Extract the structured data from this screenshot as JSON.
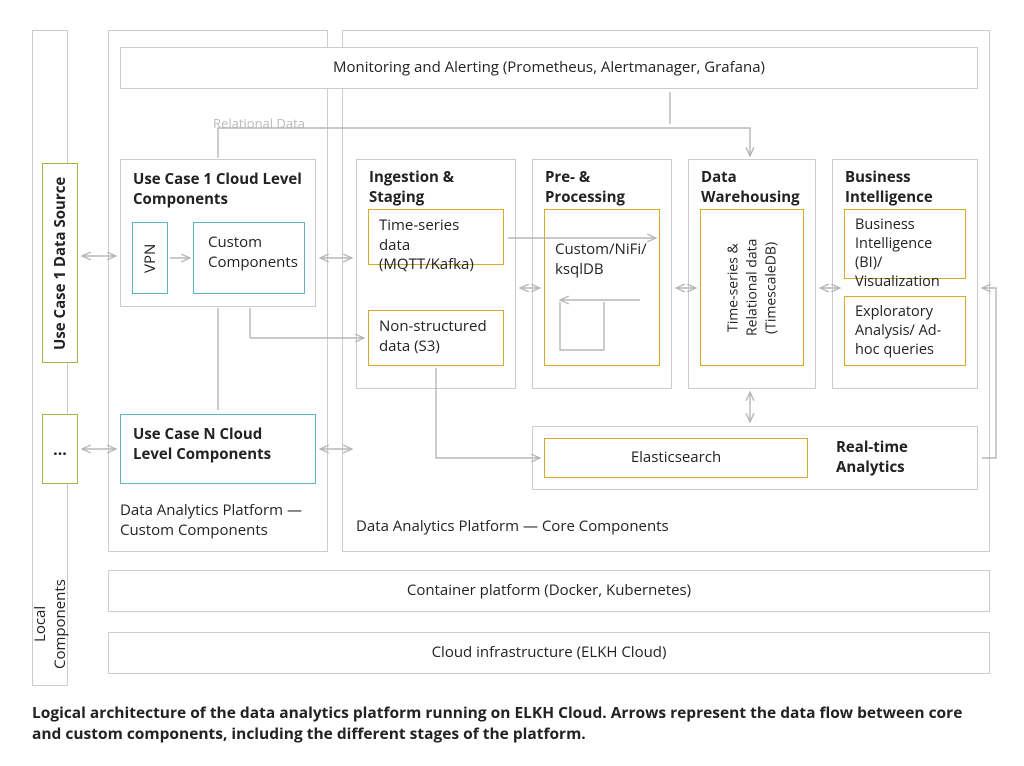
{
  "local_components_label": "Local\nComponents",
  "data_sources": {
    "use_case_1": "Use Case 1 Data Source",
    "more": "..."
  },
  "left_cluster": {
    "uc1": {
      "title": "Use Case 1 Cloud Level Components",
      "vpn": "VPN",
      "custom": "Custom Components"
    },
    "ucN_title": "Use Case N Cloud Level Components",
    "footer": "Data Analytics Platform — Custom Components"
  },
  "core": {
    "monitoring": "Monitoring and Alerting (Prometheus, Alertmanager, Grafana)",
    "relational_hint": "Relational Data",
    "ingestion": {
      "title": "Ingestion & Staging",
      "ts": "Time-series data (MQTT/Kafka)",
      "ns": "Non-structured data (S3)"
    },
    "processing": {
      "title": "Pre- & Processing",
      "body": "Custom/NiFi/ ksqlDB"
    },
    "warehouse": {
      "title": "Data Warehousing",
      "body": "Time-series & Relational data (TimescaleDB)"
    },
    "bi": {
      "title": "Business Intelligence",
      "biviz": "Business Intelligence (BI)/ Visualization",
      "explore": "Exploratory Analysis/ Ad-hoc queries"
    },
    "realtime": {
      "title": "Real-time Analytics",
      "es": "Elasticsearch"
    },
    "footer": "Data Analytics Platform — Core Components"
  },
  "infra": {
    "container": "Container platform (Docker, Kubernetes)",
    "cloud": "Cloud infrastructure (ELKH Cloud)"
  },
  "caption": "Logical architecture of the data analytics platform running on ELKH Cloud. Arrows represent the data flow between core and custom components, including the different stages of the platform."
}
